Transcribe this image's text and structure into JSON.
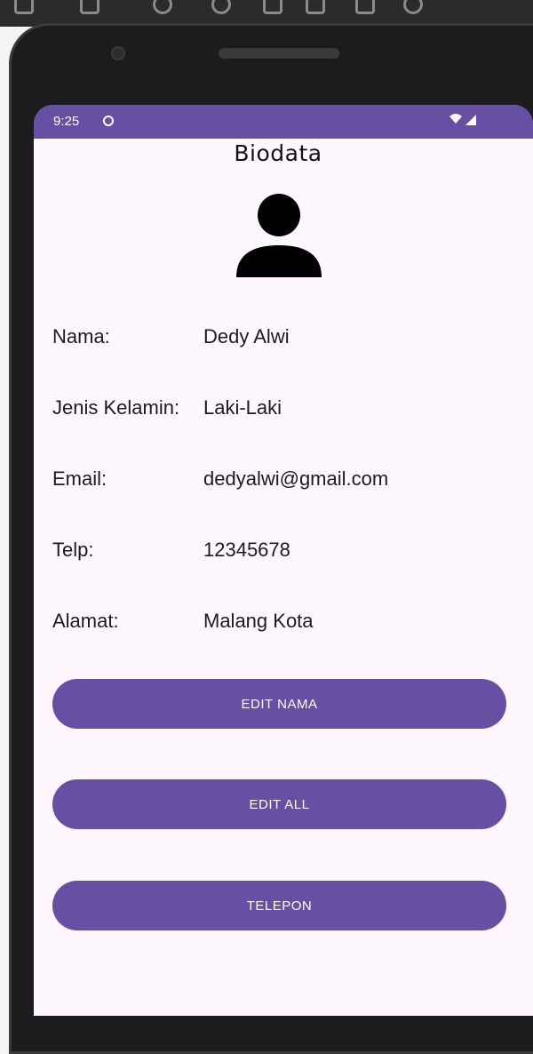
{
  "status_bar": {
    "time": "9:25",
    "background": "#6750a4"
  },
  "page": {
    "title": "Biodata",
    "avatar_icon": "person-icon"
  },
  "fields": [
    {
      "label": "Nama:",
      "value": "Dedy Alwi"
    },
    {
      "label": "Jenis Kelamin:",
      "value": "Laki-Laki"
    },
    {
      "label": "Email:",
      "value": "dedyalwi@gmail.com"
    },
    {
      "label": "Telp:",
      "value": "12345678"
    },
    {
      "label": "Alamat:",
      "value": "Malang Kota"
    }
  ],
  "buttons": {
    "edit_nama": "EDIT NAMA",
    "edit_all": "EDIT ALL",
    "telepon": "TELEPON"
  },
  "colors": {
    "accent": "#6750a4",
    "screen_background": "#fef7ff"
  }
}
